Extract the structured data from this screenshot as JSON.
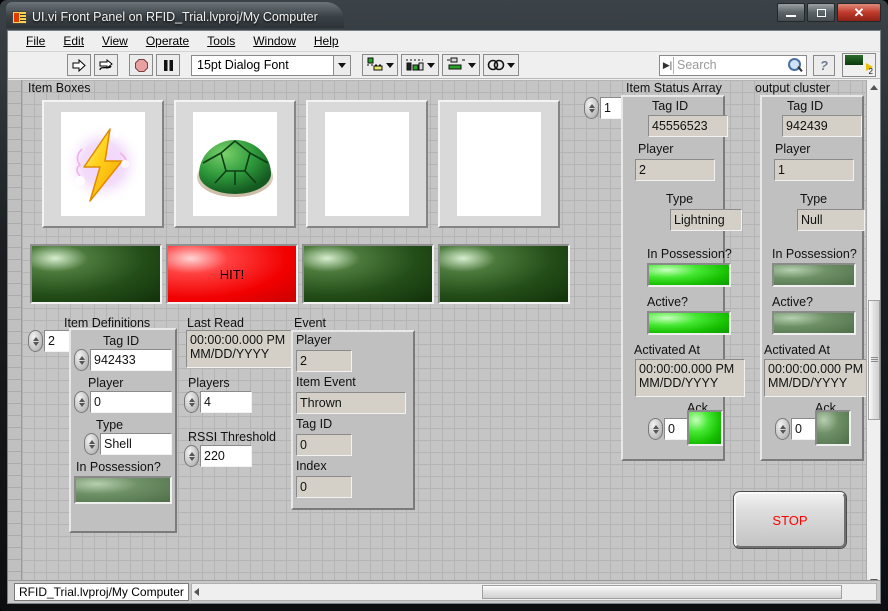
{
  "window": {
    "title": "UI.vi Front Panel on RFID_Trial.lvproj/My Computer",
    "icon": "labview-vi-icon",
    "minimize": "minimize-icon",
    "maximize": "maximize-icon",
    "close": "close-icon"
  },
  "menu": {
    "items": [
      "File",
      "Edit",
      "View",
      "Operate",
      "Tools",
      "Window",
      "Help"
    ]
  },
  "toolbar": {
    "run_icon": "run-arrow-icon",
    "run_continuous_icon": "run-continuously-icon",
    "abort_icon": "abort-execution-icon",
    "pause_icon": "pause-icon",
    "font": "15pt Dialog Font",
    "align_icon": "align-objects-icon",
    "distribute_icon": "distribute-objects-icon",
    "resize_icon": "resize-objects-icon",
    "reorder_icon": "reorder-objects-icon",
    "search_placeholder": "Search",
    "search_value": "",
    "search_icon": "magnifier-icon",
    "help_icon": "context-help-icon",
    "connector_pane_num": "2"
  },
  "panel": {
    "item_boxes": {
      "label": "Item Boxes",
      "boxes": [
        {
          "name": "lightning-bolt-image",
          "content": "lightning"
        },
        {
          "name": "green-shell-image",
          "content": "shell"
        },
        {
          "name": "empty-image-3",
          "content": "empty"
        },
        {
          "name": "empty-image-4",
          "content": "empty"
        }
      ],
      "bars": [
        {
          "name": "hit-indicator-1",
          "state": "off",
          "text": ""
        },
        {
          "name": "hit-indicator-2",
          "state": "on",
          "text": "HIT!"
        },
        {
          "name": "hit-indicator-3",
          "state": "off",
          "text": ""
        },
        {
          "name": "hit-indicator-4",
          "state": "off",
          "text": ""
        }
      ]
    },
    "item_definitions": {
      "label": "Item Definitions",
      "index": "2",
      "tag_id_label": "Tag ID",
      "tag_id": "942433",
      "player_label": "Player",
      "player": "0",
      "type_label": "Type",
      "type": "Shell",
      "in_possession_label": "In Possession?",
      "in_possession": "off"
    },
    "last_read": {
      "label": "Last Read",
      "timestamp_line1": "00:00:00.000 PM",
      "timestamp_line2": "MM/DD/YYYY",
      "players_label": "Players",
      "players": "4",
      "rssi_label": "RSSI Threshold",
      "rssi": "220"
    },
    "event": {
      "label": "Event",
      "player_label": "Player",
      "player": "2",
      "item_event_label": "Item Event",
      "item_event": "Thrown",
      "tag_id_label": "Tag ID",
      "tag_id": "0",
      "index_label": "Index",
      "index": "0"
    },
    "item_status_array": {
      "label": "Item Status Array",
      "index": "1",
      "tag_id_label": "Tag ID",
      "tag_id": "45556523",
      "player_label": "Player",
      "player": "2",
      "type_label": "Type",
      "type": "Lightning",
      "in_possession_label": "In Possession?",
      "in_possession": "on",
      "active_label": "Active?",
      "active": "on",
      "activated_at_label": "Activated At",
      "activated_line1": "00:00:00.000 PM",
      "activated_line2": "MM/DD/YYYY",
      "ack_label": "Ack",
      "ack_value": "0",
      "ack_led": "on"
    },
    "output_cluster": {
      "label": "output cluster",
      "tag_id_label": "Tag ID",
      "tag_id": "942439",
      "player_label": "Player",
      "player": "1",
      "type_label": "Type",
      "type": "Null",
      "in_possession_label": "In Possession?",
      "in_possession": "off",
      "active_label": "Active?",
      "active": "off",
      "activated_at_label": "Activated At",
      "activated_line1": "00:00:00.000 PM",
      "activated_line2": "MM/DD/YYYY",
      "ack_label": "Ack",
      "ack_value": "0",
      "ack_led": "off"
    },
    "stop_button": "STOP"
  },
  "statusbar": {
    "target": "RFID_Trial.lvproj/My Computer"
  }
}
